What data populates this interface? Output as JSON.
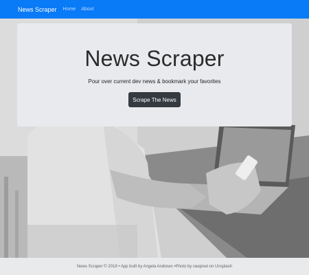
{
  "navbar": {
    "brand": "News Scraper",
    "links": [
      "Home",
      "About"
    ],
    "color": "#0a7bf7"
  },
  "hero": {
    "title": "News Scraper",
    "subtitle": "Pour over current dev news & bookmark your favorites",
    "button_label": "Scrape The News"
  },
  "footer": {
    "text": "News Scraper © 2018 • App built by Angela Andrews •Photo by rawpixel on Unsplash"
  }
}
